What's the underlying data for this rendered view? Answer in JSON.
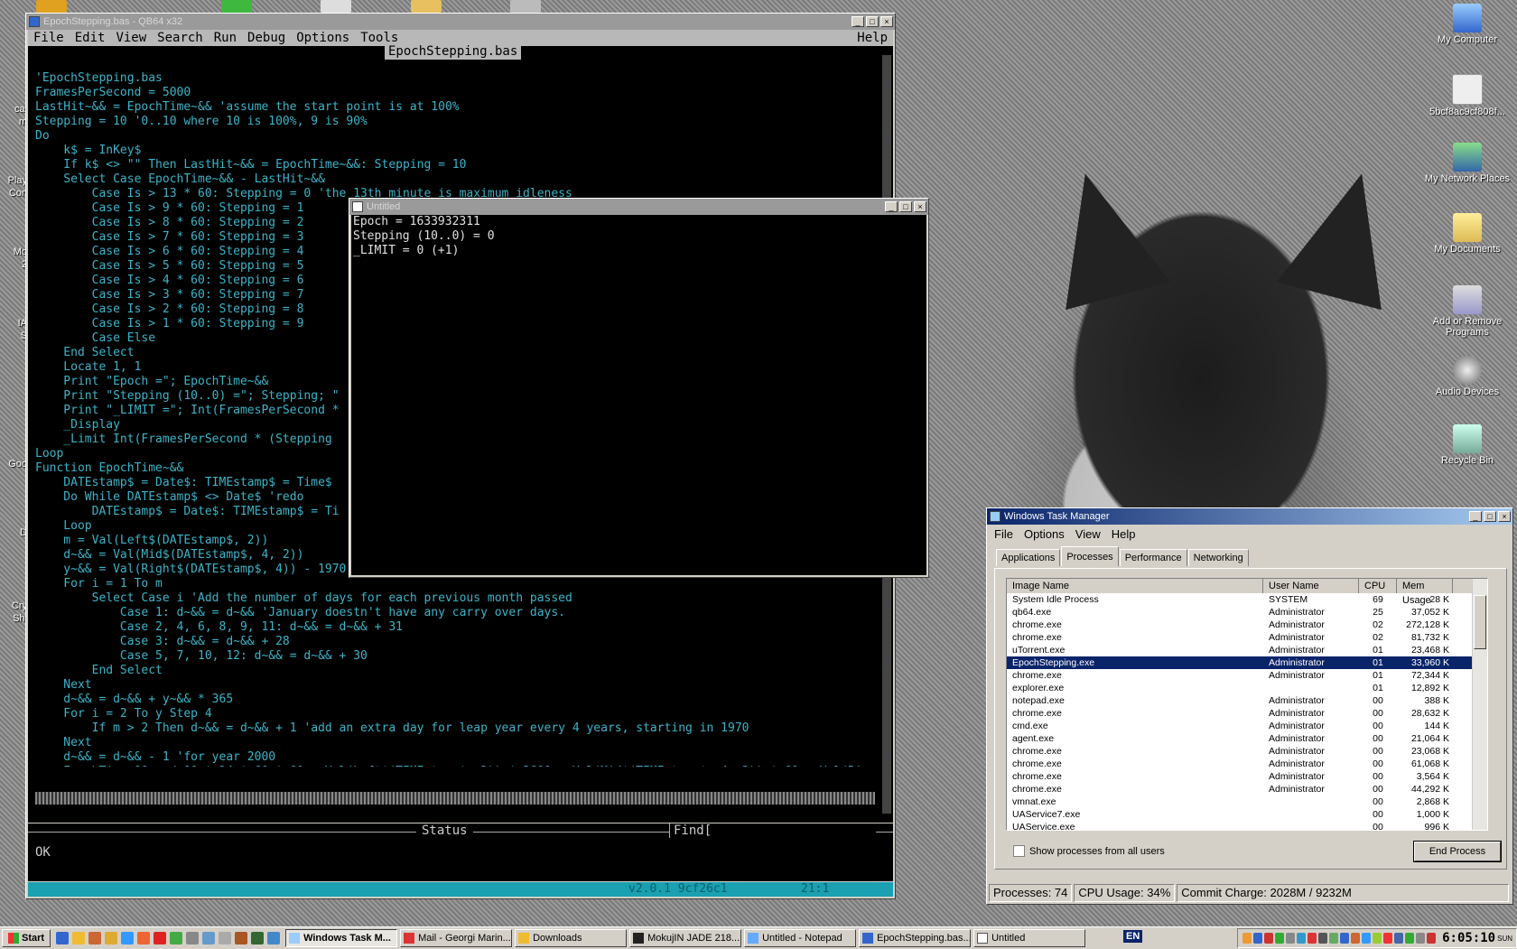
{
  "desktop": {
    "icons_right": [
      {
        "label": "My Computer"
      },
      {
        "label": "5bcf8ac9cf808f..."
      },
      {
        "label": "My Network Places"
      },
      {
        "label": "My Documents"
      },
      {
        "label": "Add or Remove Programs"
      },
      {
        "label": "Audio Devices"
      },
      {
        "label": "Recycle Bin"
      }
    ],
    "icons_left_partial": [
      "cal",
      "m",
      "Play",
      "Con",
      "Mo",
      "2",
      "IA",
      "S",
      "Goo",
      "D",
      "Cry",
      "Shi"
    ]
  },
  "qb64": {
    "title": "EpochStepping.bas - QB64 x32",
    "menu": [
      "File",
      "Edit",
      "View",
      "Search",
      "Run",
      "Debug",
      "Options",
      "Tools"
    ],
    "help": "Help",
    "tab": "EpochStepping.bas",
    "code": [
      "'EpochStepping.bas",
      "FramesPerSecond = 5000",
      "LastHit~&& = EpochTime~&& 'assume the start point is at 100%",
      "Stepping = 10 '0..10 where 10 is 100%, 9 is 90%",
      "Do",
      "    k$ = InKey$",
      "    If k$ <> \"\" Then LastHit~&& = EpochTime~&&: Stepping = 10",
      "    Select Case EpochTime~&& - LastHit~&&",
      "        Case Is > 13 * 60: Stepping = 0 'the 13th minute is maximum idleness",
      "        Case Is > 9 * 60: Stepping = 1",
      "        Case Is > 8 * 60: Stepping = 2",
      "        Case Is > 7 * 60: Stepping = 3",
      "        Case Is > 6 * 60: Stepping = 4",
      "        Case Is > 5 * 60: Stepping = 5",
      "        Case Is > 4 * 60: Stepping = 6",
      "        Case Is > 3 * 60: Stepping = 7",
      "        Case Is > 2 * 60: Stepping = 8",
      "        Case Is > 1 * 60: Stepping = 9",
      "        Case Else",
      "    End Select",
      "    Locate 1, 1",
      "    Print \"Epoch =\"; EpochTime~&&",
      "    Print \"Stepping (10..0) =\"; Stepping; \"",
      "    Print \"_LIMIT =\"; Int(FramesPerSecond *",
      "    _Display",
      "    _Limit Int(FramesPerSecond * (Stepping",
      "Loop",
      "",
      "Function EpochTime~&&",
      "    DATEstamp$ = Date$: TIMEstamp$ = Time$",
      "    Do While DATEstamp$ <> Date$ 'redo",
      "        DATEstamp$ = Date$: TIMEstamp$ = Ti",
      "    Loop",
      "    m = Val(Left$(DATEstamp$, 2))",
      "    d~&& = Val(Mid$(DATEstamp$, 4, 2))",
      "    y~&& = Val(Right$(DATEstamp$, 4)) - 1970",
      "    For i = 1 To m",
      "        Select Case i 'Add the number of days for each previous month passed",
      "            Case 1: d~&& = d~&& 'January doestn't have any carry over days.",
      "            Case 2, 4, 6, 8, 9, 11: d~&& = d~&& + 31",
      "            Case 3: d~&& = d~&& + 28",
      "            Case 5, 7, 10, 12: d~&& = d~&& + 30",
      "        End Select",
      "    Next",
      "    d~&& = d~&& + y~&& * 365",
      "    For i = 2 To y Step 4",
      "        If m > 2 Then d~&& = d~&& + 1 'add an extra day for leap year every 4 years, starting in 1970",
      "    Next",
      "    d~&& = d~&& - 1 'for year 2000",
      "    EpochTime~&& = d~&& * 24 * 60 * 60 + Val(Left$(TIMEstamp$, 2)) * 3600 + Val(Mid$(TIMEstamp$, 4, 2)) * 60 + Val(Rig",
      "End Function"
    ],
    "status_label": "Status",
    "find_label": "Find[",
    "status_text": "OK",
    "version": "v2.0.1 9cf26c1",
    "cursor_pos": "21:1"
  },
  "console_window": {
    "title": "Untitled",
    "lines": [
      "Epoch = 1633932311",
      "Stepping (10..0) = 0",
      "_LIMIT = 0 (+1)"
    ]
  },
  "task_manager": {
    "title": "Windows Task Manager",
    "menu": [
      "File",
      "Options",
      "View",
      "Help"
    ],
    "tabs": [
      "Applications",
      "Processes",
      "Performance",
      "Networking"
    ],
    "selected_tab": "Processes",
    "columns": [
      "Image Name",
      "User Name",
      "CPU",
      "Mem Usage"
    ],
    "rows": [
      {
        "name": "System Idle Process",
        "user": "SYSTEM",
        "cpu": "69",
        "mem": "28 K"
      },
      {
        "name": "qb64.exe",
        "user": "Administrator",
        "cpu": "25",
        "mem": "37,052 K"
      },
      {
        "name": "chrome.exe",
        "user": "Administrator",
        "cpu": "02",
        "mem": "272,128 K"
      },
      {
        "name": "chrome.exe",
        "user": "Administrator",
        "cpu": "02",
        "mem": "81,732 K"
      },
      {
        "name": "uTorrent.exe",
        "user": "Administrator",
        "cpu": "01",
        "mem": "23,468 K"
      },
      {
        "name": "EpochStepping.exe",
        "user": "Administrator",
        "cpu": "01",
        "mem": "33,960 K"
      },
      {
        "name": "chrome.exe",
        "user": "Administrator",
        "cpu": "01",
        "mem": "72,344 K"
      },
      {
        "name": "explorer.exe",
        "user": "",
        "cpu": "01",
        "mem": "12,892 K"
      },
      {
        "name": "notepad.exe",
        "user": "Administrator",
        "cpu": "00",
        "mem": "388 K"
      },
      {
        "name": "chrome.exe",
        "user": "Administrator",
        "cpu": "00",
        "mem": "28,632 K"
      },
      {
        "name": "cmd.exe",
        "user": "Administrator",
        "cpu": "00",
        "mem": "144 K"
      },
      {
        "name": "agent.exe",
        "user": "Administrator",
        "cpu": "00",
        "mem": "21,064 K"
      },
      {
        "name": "chrome.exe",
        "user": "Administrator",
        "cpu": "00",
        "mem": "23,068 K"
      },
      {
        "name": "chrome.exe",
        "user": "Administrator",
        "cpu": "00",
        "mem": "61,068 K"
      },
      {
        "name": "chrome.exe",
        "user": "Administrator",
        "cpu": "00",
        "mem": "3,564 K"
      },
      {
        "name": "chrome.exe",
        "user": "Administrator",
        "cpu": "00",
        "mem": "44,292 K"
      },
      {
        "name": "vmnat.exe",
        "user": "",
        "cpu": "00",
        "mem": "2,868 K"
      },
      {
        "name": "UAService7.exe",
        "user": "",
        "cpu": "00",
        "mem": "1,000 K"
      },
      {
        "name": "UAService.exe",
        "user": "",
        "cpu": "00",
        "mem": "996 K"
      }
    ],
    "selected_row": "EpochStepping.exe",
    "show_all_label": "Show processes from all users",
    "end_process_label": "End Process",
    "status": {
      "processes": "Processes: 74",
      "cpu": "CPU Usage: 34%",
      "commit": "Commit Charge: 2028M / 9232M"
    }
  },
  "taskbar": {
    "start_label": "Start",
    "buttons": [
      {
        "label": "Windows Task M...",
        "active": true
      },
      {
        "label": "Mail - Georgi Marin...",
        "active": false
      },
      {
        "label": "Downloads",
        "active": false
      },
      {
        "label": "MokujIN JADE 218...",
        "active": false
      },
      {
        "label": "Untitled - Notepad",
        "active": false
      },
      {
        "label": "EpochStepping.bas...",
        "active": false
      },
      {
        "label": "Untitled",
        "active": false
      }
    ],
    "language": "EN",
    "clock": "6:05:10",
    "day": "SUN"
  },
  "colors": {
    "code_text": "#3cb4c8",
    "qb_background": "#000000",
    "selection": "#0a246a"
  }
}
